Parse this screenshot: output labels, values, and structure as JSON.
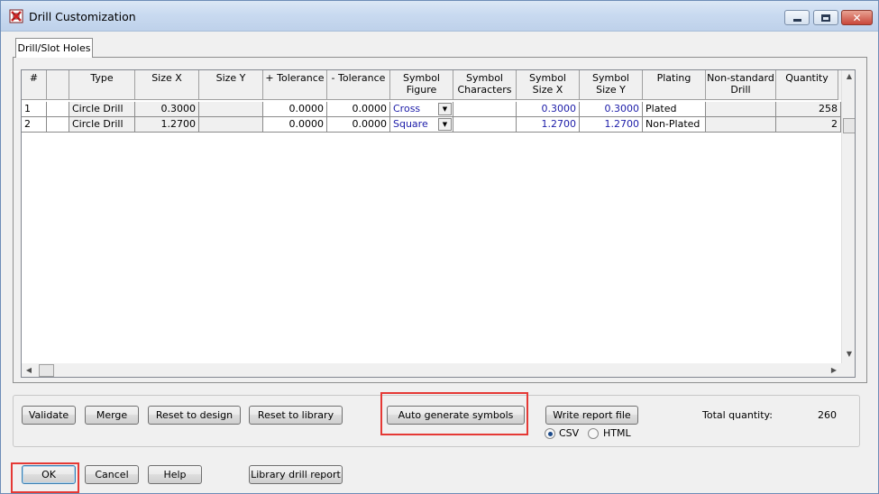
{
  "window": {
    "title": "Drill Customization",
    "icon": "drill-app-icon",
    "controls": [
      "minimize-icon",
      "maximize-icon",
      "close-icon"
    ]
  },
  "tabs": [
    {
      "label": "Drill/Slot Holes",
      "active": true
    }
  ],
  "table": {
    "columns": [
      "#",
      "",
      "Type",
      "Size X",
      "Size Y",
      "+ Tolerance",
      "- Tolerance",
      "Symbol\nFigure",
      "Symbol\nCharacters",
      "Symbol\nSize X",
      "Symbol\nSize Y",
      "Plating",
      "Non-standard\nDrill",
      "Quantity"
    ],
    "rows": [
      {
        "num": "1",
        "flag": "",
        "type": "Circle Drill",
        "size_x": "0.3000",
        "size_y": "",
        "plus_tol": "0.0000",
        "minus_tol": "0.0000",
        "symbol_figure": "Cross",
        "symbol_chars": "",
        "symbol_size_x": "0.3000",
        "symbol_size_y": "0.3000",
        "plating": "Plated",
        "nonstandard": "",
        "quantity": "258"
      },
      {
        "num": "2",
        "flag": "",
        "type": "Circle Drill",
        "size_x": "1.2700",
        "size_y": "",
        "plus_tol": "0.0000",
        "minus_tol": "0.0000",
        "symbol_figure": "Square",
        "symbol_chars": "",
        "symbol_size_x": "1.2700",
        "symbol_size_y": "1.2700",
        "plating": "Non-Plated",
        "nonstandard": "",
        "quantity": "2"
      }
    ],
    "accent_value_color": "#1c1ca8"
  },
  "actions": {
    "validate": "Validate",
    "merge": "Merge",
    "reset_design": "Reset to design",
    "reset_library": "Reset to library",
    "auto_generate": "Auto generate symbols",
    "write_report": "Write report file",
    "format_csv": "CSV",
    "format_html": "HTML",
    "selected_format": "CSV",
    "total_label": "Total quantity:",
    "total_value": "260"
  },
  "footer": {
    "ok": "OK",
    "cancel": "Cancel",
    "help": "Help",
    "library_report": "Library drill report"
  },
  "annotation_color": "#e53935"
}
